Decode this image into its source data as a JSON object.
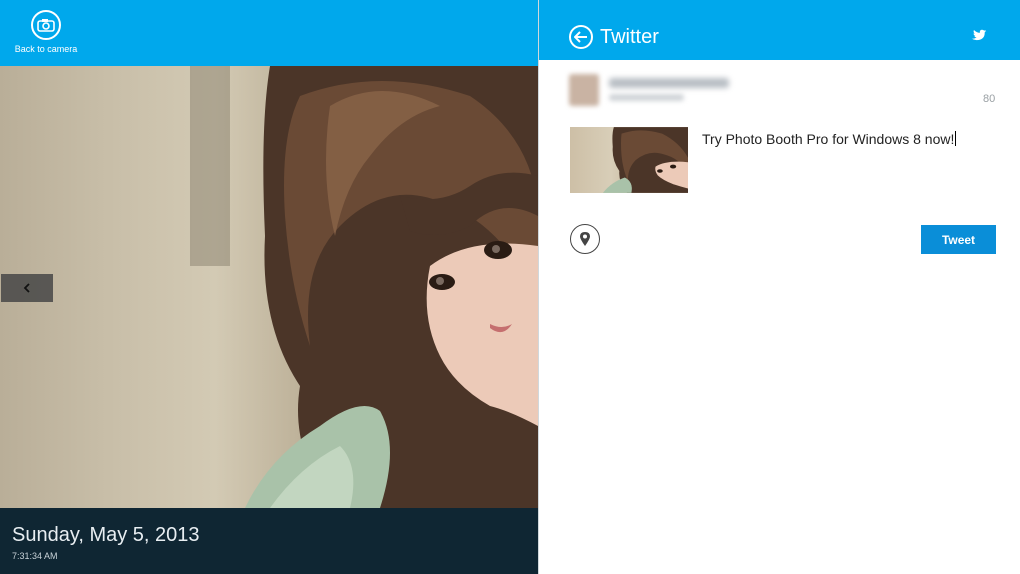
{
  "left_pane": {
    "camera_button_label": "Back to camera",
    "prev_arrow": "‹",
    "date": "Sunday, May 5, 2013",
    "time": "7:31:34 AM"
  },
  "share_pane": {
    "title": "Twitter",
    "char_count": "80",
    "tweet_text": "Try Photo Booth Pro for Windows 8 now!",
    "tweet_button": "Tweet"
  },
  "colors": {
    "accent": "#00a8ec",
    "tweet_button": "#0a8ed8",
    "info_bar": "#0f2633"
  },
  "icons": {
    "camera": "camera-icon",
    "back": "back-arrow-icon",
    "twitter": "twitter-bird-icon",
    "location": "location-pin-icon",
    "prev": "chevron-left-icon"
  }
}
